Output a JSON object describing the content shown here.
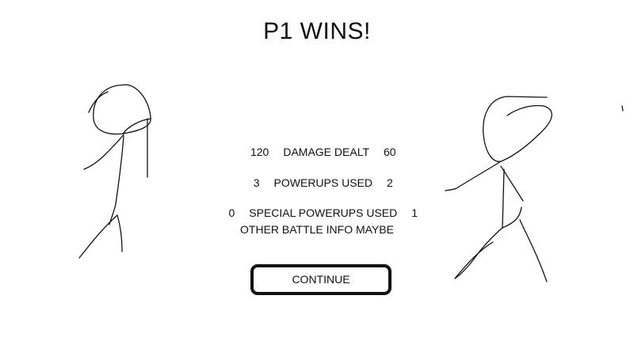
{
  "title": "P1 WINS!",
  "stats": [
    {
      "p1": "120",
      "label": "DAMAGE DEALT",
      "p2": "60"
    },
    {
      "p1": "3",
      "label": "POWERUPS USED",
      "p2": "2"
    },
    {
      "p1": "0",
      "label": "SPECIAL POWERUPS USED",
      "p2": "1"
    }
  ],
  "extra_info": "OTHER BATTLE INFO MAYBE",
  "continue_label": "CONTINUE",
  "colors": {
    "background": "#ffffff",
    "ink": "#111111"
  }
}
